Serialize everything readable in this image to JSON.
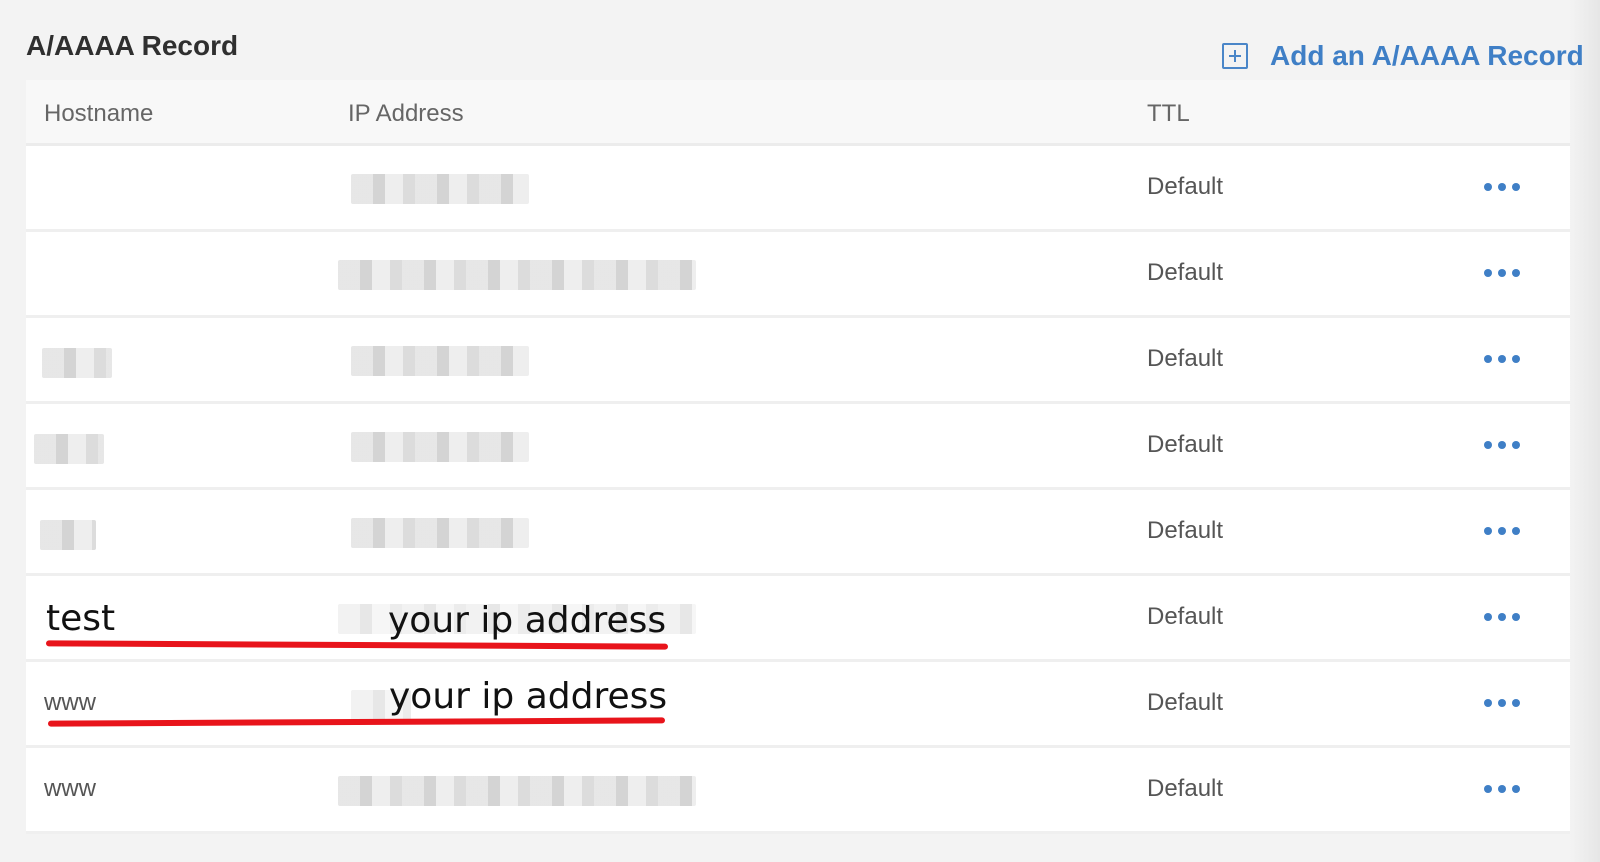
{
  "section": {
    "title": "A/AAAA Record",
    "add_label": "Add an A/AAAA Record"
  },
  "columns": {
    "hostname": "Hostname",
    "ip": "IP Address",
    "ttl": "TTL"
  },
  "rows": [
    {
      "hostname": "",
      "ttl": "Default",
      "hostname_blurred": false,
      "ip_blur": "short"
    },
    {
      "hostname": "",
      "ttl": "Default",
      "hostname_blurred": false,
      "ip_blur": "long"
    },
    {
      "hostname": "",
      "ttl": "Default",
      "hostname_blurred": true,
      "ip_blur": "short"
    },
    {
      "hostname": "",
      "ttl": "Default",
      "hostname_blurred": true,
      "ip_blur": "short"
    },
    {
      "hostname": "",
      "ttl": "Default",
      "hostname_blurred": true,
      "ip_blur": "short"
    },
    {
      "hostname": "test",
      "ttl": "Default",
      "ip_annotation": "your ip address"
    },
    {
      "hostname": "www",
      "ttl": "Default",
      "ip_annotation": "your ip address"
    },
    {
      "hostname": "www",
      "ttl": "Default",
      "hostname_blurred": false,
      "ip_blur": "long"
    }
  ],
  "colors": {
    "accent": "#3f7fc6",
    "annotation_underline": "#e8141b"
  },
  "icons": {
    "add": "plus-square-icon",
    "row_menu": "more-horizontal-icon"
  }
}
